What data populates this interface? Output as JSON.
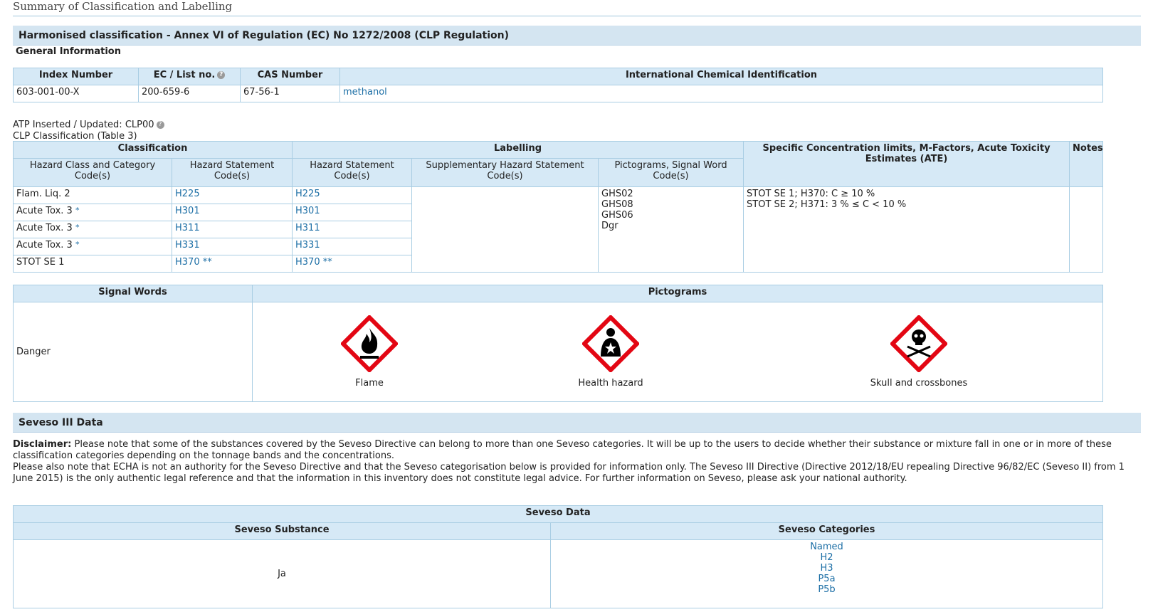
{
  "page_title": "Summary of Classification and Labelling",
  "harmonised": {
    "title": "Harmonised classification - Annex VI of Regulation (EC) No 1272/2008 (CLP Regulation)",
    "general_info": "General Information",
    "headers": [
      "Index Number",
      "EC / List no.",
      "CAS Number",
      "International Chemical Identification"
    ],
    "row": [
      "603-001-00-X",
      "200-659-6",
      "67-56-1",
      "methanol"
    ]
  },
  "atp": "ATP Inserted / Updated: CLP00",
  "clp_table_label": "CLP Classification (Table 3)",
  "clp": {
    "group_headers": {
      "classification": "Classification",
      "labelling": "Labelling",
      "limits": "Specific Concentration limits, M-Factors, Acute Toxicity Estimates (ATE)",
      "notes": "Notes"
    },
    "sub_headers": {
      "hazard_class": "Hazard Class and Category Code(s)",
      "hazard_statement": "Hazard Statement Code(s)",
      "label_hazard_statement": "Hazard Statement Code(s)",
      "supplementary": "Supplementary Hazard Statement Code(s)",
      "pictograms": "Pictograms, Signal Word Code(s)"
    },
    "rows": [
      {
        "class": "Flam. Liq. 2",
        "class_mark": "",
        "h": "H225",
        "h_mark": "",
        "lh": "H225",
        "lh_mark": ""
      },
      {
        "class": "Acute Tox. 3",
        "class_mark": "*",
        "h": "H301",
        "h_mark": "",
        "lh": "H301",
        "lh_mark": ""
      },
      {
        "class": "Acute Tox. 3",
        "class_mark": "*",
        "h": "H311",
        "h_mark": "",
        "lh": "H311",
        "lh_mark": ""
      },
      {
        "class": "Acute Tox. 3",
        "class_mark": "*",
        "h": "H331",
        "h_mark": "",
        "lh": "H331",
        "lh_mark": ""
      },
      {
        "class": "STOT SE 1",
        "class_mark": "",
        "h": "H370",
        "h_mark": "**",
        "lh": "H370",
        "lh_mark": "**"
      }
    ],
    "pictogram_codes": [
      "GHS02",
      "GHS08",
      "GHS06",
      "Dgr"
    ],
    "limits": [
      "STOT SE 1; H370: C ≥ 10 %",
      "STOT SE 2; H371: 3 % ≤ C < 10 %"
    ],
    "notes": ""
  },
  "signal": {
    "header_signal": "Signal Words",
    "header_picto": "Pictograms",
    "signal_word": "Danger",
    "pictograms": [
      {
        "icon": "flame-pictogram",
        "label": "Flame"
      },
      {
        "icon": "health-hazard-pictogram",
        "label": "Health hazard"
      },
      {
        "icon": "skull-crossbones-pictogram",
        "label": "Skull and crossbones"
      }
    ],
    "colors": {
      "border": "#e30613",
      "symbol": "#000000"
    }
  },
  "seveso": {
    "title": "Seveso III Data",
    "disclaimer_label": "Disclaimer:",
    "disclaimer_1": "Please note that some of the substances covered by the Seveso Directive can belong to more than one Seveso categories. It will be up to the users to decide whether their substance or mixture fall in one or in more of these classification categories depending on the tonnage bands and the concentrations.",
    "disclaimer_2": "Please also note that ECHA is not an authority for the Seveso Directive and that the Seveso categorisation below is provided for information only. The Seveso III Directive (Directive 2012/18/EU repealing Directive 96/82/EC (Seveso II) from 1 June 2015) is the only authentic legal reference and that the information in this inventory does not constitute legal advice. For further information on Seveso, please ask your national authority.",
    "table_title": "Seveso Data",
    "col_substance": "Seveso Substance",
    "col_categories": "Seveso Categories",
    "substance_value": "Ja",
    "categories": [
      "Named",
      "H2",
      "H3",
      "P5a",
      "P5b"
    ]
  }
}
